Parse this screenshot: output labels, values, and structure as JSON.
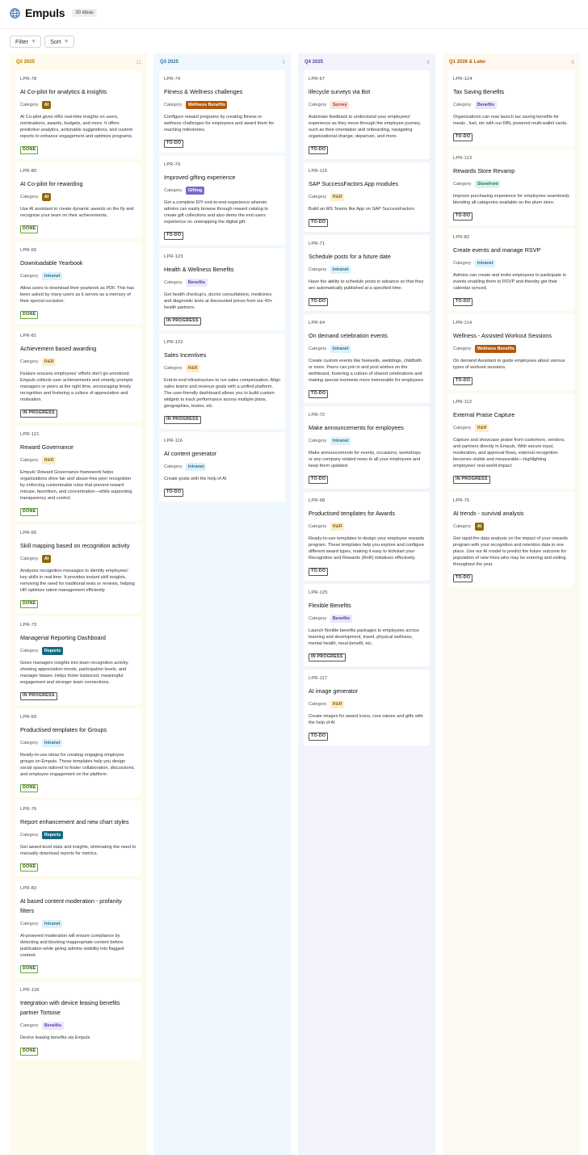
{
  "app": {
    "icon": "globe-icon",
    "title": "Empuls",
    "idea_count": "30 ideas"
  },
  "toolbar": {
    "filter_label": "Filter",
    "sort_label": "Sort"
  },
  "colors": {
    "AI": {
      "bg": "#8d6a0c",
      "fg": "#ffffff"
    },
    "R&R": {
      "bg": "#fbeccc",
      "fg": "#8d6a0c"
    },
    "Intranet": {
      "bg": "#dcf1fa",
      "fg": "#2e7396"
    },
    "Reports": {
      "bg": "#146a80",
      "fg": "#ffffff"
    },
    "Benefits": {
      "bg": "#ece6fb",
      "fg": "#5c3ea6"
    },
    "Wellness Benefits": {
      "bg": "#b2580a",
      "fg": "#ffffff"
    },
    "Gifting": {
      "bg": "#7b68c9",
      "fg": "#ffffff"
    },
    "Survey": {
      "bg": "#fbe3dd",
      "fg": "#b23a22"
    },
    "Storefront": {
      "bg": "#d9f4ea",
      "fg": "#1b7a55"
    }
  },
  "columns": [
    {
      "name": "Q2 2025",
      "count": "11",
      "bg": "#fefaec",
      "name_color": "#b07a0a",
      "cards": [
        {
          "id": "LPR-78",
          "title": "AI Co-pilot for analytics & insights",
          "category_label": "Category",
          "category": "AI",
          "description": "AI Co-pilot gives HRs real-time insights on users, nominations, awards, budgets, and more. It offers predictive analytics, actionable suggestions, and custom reports to enhance engagement and optimize programs.",
          "status": "DONE"
        },
        {
          "id": "LPR-80",
          "title": "AI Co-pilot for rewarding",
          "category_label": "Category",
          "category": "AI",
          "description": "Use AI assistant to create dynamic awards on the fly and recognise your team on their achievements.",
          "status": "DONE"
        },
        {
          "id": "LPR-65",
          "title": "Downloadable Yearbook",
          "category_label": "Category",
          "category": "Intranet",
          "description": "Allow users to download their yearbook as PDF. This has been asked by many users as it serves as a memory of their special occasion.",
          "status": "DONE"
        },
        {
          "id": "LPR-81",
          "title": "Achievement based awarding",
          "category_label": "Category",
          "category": "R&R",
          "description": "Feature ensures employees' efforts don't go unnoticed. Empuls collects user achievements and smartly prompts managers or peers at the right time, encouraging timely recognition and fostering a culture of appreciation and motivation.",
          "status": "IN PROGRESS"
        },
        {
          "id": "LPR-121",
          "title": "Reward Governance",
          "category_label": "Category",
          "category": "R&R",
          "description": "Empuls' Reward Governance framework helps organizations drive fair and abuse-free peer recognition by enforcing customizable rules that prevent reward misuse, favoritism, and concentration—while supporting transparency and control.",
          "status": "DONE"
        },
        {
          "id": "LPR-66",
          "title": "Skill mapping based on recognition activity",
          "category_label": "Category",
          "category": "AI",
          "description": "Analyzes recognition messages to identify employees' key skills in real time. It provides instant skill insights, removing the need for traditional tests or reviews, helping HR optimize talent management efficiently.",
          "status": "DONE"
        },
        {
          "id": "LPR-73",
          "title": "Managerial Reporting Dashboard",
          "category_label": "Category",
          "category": "Reports",
          "description": "Gives managers insights into team recognition activity, showing appreciation trends, participation levels, and manager biases. Helps foster balanced, meaningful engagement and stronger team connections.",
          "status": "IN PROGRESS"
        },
        {
          "id": "LPR-69",
          "title": "Productised templates for Groups",
          "category_label": "Category",
          "category": "Intranet",
          "description": "Ready-to-use ideas for creating engaging employee groups on Empuls. These templates help you design social spaces tailored to foster collaboration, discussions, and employee engagement on the platform.",
          "status": "DONE"
        },
        {
          "id": "LPR-76",
          "title": "Report enhancement and new chart styles",
          "category_label": "Category",
          "category": "Reports",
          "description": "Get award-level stats and insights, eliminating the need to manually download reports for metrics.",
          "status": "DONE"
        },
        {
          "id": "LPR-83",
          "title": "AI based content moderation - profanity filters",
          "category_label": "Category",
          "category": "Intranet",
          "description": "AI-powered moderation will ensure compliance by detecting and blocking inappropriate content before publication while giving admins visibility into flagged content.",
          "status": "DONE"
        },
        {
          "id": "LPR-118",
          "title": "Integration with device leasing benefits partner Tortoise",
          "category_label": "Category",
          "category": "Benefits",
          "description": "Device leasing benefits via Empuls",
          "status": "DONE"
        }
      ]
    },
    {
      "name": "Q3 2025",
      "count": "5",
      "bg": "#eff8fd",
      "name_color": "#2e7396",
      "cards": [
        {
          "id": "LPR-74",
          "title": "Fitness & Wellness challenges",
          "category_label": "Category",
          "category": "Wellness Benefits",
          "description": "Configure reward programs by creating fitness or wellness challenges for employees and award them for reaching milestones.",
          "status": "TO-DO"
        },
        {
          "id": "LPR-79",
          "title": "Improved gifting experience",
          "category_label": "Category",
          "category": "Gifting",
          "description": "Get a complete DIY end-to-end experience wherein admins can easily browse through reward catalog to create gift collections and also demo the end users experience on unwrapping the digital gift.",
          "status": "TO-DO"
        },
        {
          "id": "LPR-123",
          "title": "Health & Wellness Benefits",
          "category_label": "Category",
          "category": "Benefits",
          "description": "Get health checkup's, doctor consultations, medicines and diagnostic tests at discounted prices from our 40+ health partners.",
          "status": "IN PROGRESS"
        },
        {
          "id": "LPR-122",
          "title": "Sales Incentives",
          "category_label": "Category",
          "category": "R&R",
          "description": "End-to-end infrastructure to run sales compensation. Align sales teams and revenue goals with a unified platform. The user-friendly dashboard allows you to build custom widgets to track performance across multiple plans, geographies, teams, etc.",
          "status": "IN PROGRESS"
        },
        {
          "id": "LPR-116",
          "title": "AI content generator",
          "category_label": "Category",
          "category": "Intranet",
          "description": "Create posts with the help of AI",
          "status": "TO-DO"
        }
      ]
    },
    {
      "name": "Q4 2025",
      "count": "8",
      "bg": "#f3f3fb",
      "name_color": "#5c3ea6",
      "cards": [
        {
          "id": "LPR-67",
          "title": "lifecycle surveys via Bot",
          "category_label": "Category",
          "category": "Survey",
          "description": "Automate feedback to understand your employees' experience as they move through the employee journey, such as their orientation and onboarding, navigating organizational change, departure, and more.",
          "status": "TO-DO"
        },
        {
          "id": "LPR-115",
          "title": "SAP SuccessFactors App modules",
          "category_label": "Category",
          "category": "R&R",
          "description": "Build an MS Teams like App on SAP SuccessFactors",
          "status": "TO-DO"
        },
        {
          "id": "LPR-71",
          "title": "Schedule posts for a future date",
          "category_label": "Category",
          "category": "Intranet",
          "description": "Have the ability to schedule posts in advance so that they are automatically published at a specified time.",
          "status": "TO-DO"
        },
        {
          "id": "LPR-64",
          "title": "On demand celebration events",
          "category_label": "Category",
          "category": "Intranet",
          "description": "Create custom events like farewells, weddings, childbirth or more. Peers can join in and post wishes on the wishboard, fostering a culture of shared celebrations and making special moments more memorable for employees",
          "status": "TO-DO"
        },
        {
          "id": "LPR-72",
          "title": "Make announcements for employees",
          "category_label": "Category",
          "category": "Intranet",
          "description": "Make announcements for events, occasions, workshops or any company related news to all your employees and keep them updated.",
          "status": "TO-DO"
        },
        {
          "id": "LPR-68",
          "title": "Productised templates for Awards",
          "category_label": "Category",
          "category": "R&R",
          "description": "Ready-to-use templates to design your employee rewards program. These templates help you explore and configure different award types, making it easy to kickstart your Recognition and Rewards (RnR) initiatives effectively.",
          "status": "TO-DO"
        },
        {
          "id": "LPR-125",
          "title": "Flexible Benefits",
          "category_label": "Category",
          "category": "Benefits",
          "description": "Launch flexible benefits packages to employees across learning and development, travel, physical wellness, mental health, meal benefit, etc.",
          "status": "IN PROGRESS"
        },
        {
          "id": "LPR-117",
          "title": "AI image generator",
          "category_label": "Category",
          "category": "R&R",
          "description": "Create images for award icons, core values and gifts with the help of AI",
          "status": "TO-DO"
        }
      ]
    },
    {
      "name": "Q1 2026 & Later",
      "count": "6",
      "bg": "#fdf9f1",
      "name_color": "#b2580a",
      "cards": [
        {
          "id": "LPR-124",
          "title": "Tax Saving Benefits",
          "category_label": "Category",
          "category": "Benefits",
          "description": "Organizations can now launch tax saving benefits for meals , fuel, etc with our RBL powered multi-wallet cards.",
          "status": "TO-DO"
        },
        {
          "id": "LPR-113",
          "title": "Rewards Store Revamp",
          "category_label": "Category",
          "category": "Storefront",
          "description": "Improve purchasing experience for employees seamlessly blending all categories available on the plum store.",
          "status": "TO-DO"
        },
        {
          "id": "LPR-82",
          "title": "Create events and manage RSVP",
          "category_label": "Category",
          "category": "Intranet",
          "description": "Admins can create and invite employees to participate in events enabling them to RSVP and thereby get their calendar synced.",
          "status": "TO-DO"
        },
        {
          "id": "LPR-114",
          "title": "Wellness - Assisted Workout Sessions",
          "category_label": "Category",
          "category": "Wellness Benefits",
          "description": "On demand Assistant to guide employees about various types of workout sessions.",
          "status": "TO-DO"
        },
        {
          "id": "LPR-112",
          "title": "External Praise Capture",
          "category_label": "Category",
          "category": "R&R",
          "description": "Capture and showcase praise from customers, vendors, and partners directly in Empuls. With secure input, moderation, and approval flows, external recognition becomes visible and measurable—highlighting employees' real-world impact.",
          "status": "IN PROGRESS"
        },
        {
          "id": "LPR-75",
          "title": "AI trends - survival analysis",
          "category_label": "Category",
          "category": "AI",
          "description": "Get rapid-fire data analysis on the impact of your rewards program with your recognition and retention data in one place. Use our AI model to predict the future outcome for population of new hires who may be entering and exiting throughout the year.",
          "status": "TO-DO"
        }
      ]
    }
  ]
}
